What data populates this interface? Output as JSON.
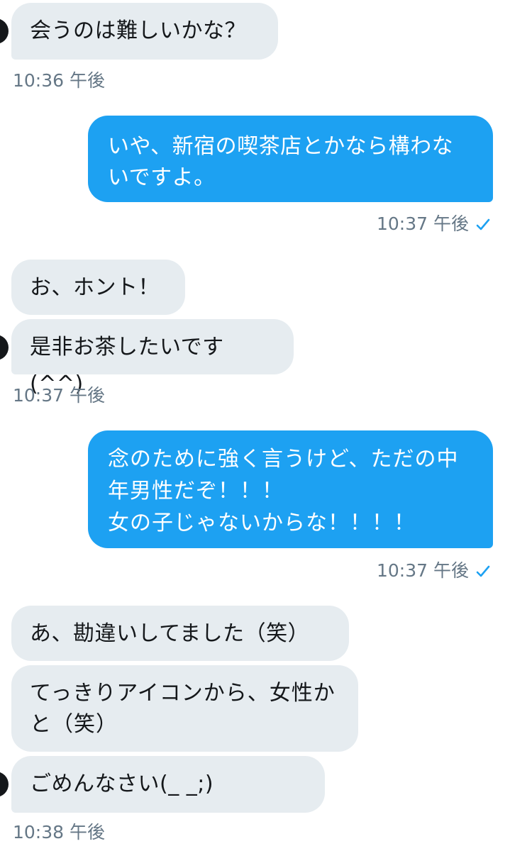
{
  "conversation": {
    "colors": {
      "incoming_bubble": "#e6ecf0",
      "outgoing_bubble": "#1da1f2",
      "timestamp": "#657786",
      "check": "#1da1f2"
    },
    "groups": [
      {
        "direction": "incoming",
        "messages": [
          "会うのは難しいかな？"
        ],
        "time": "10:36 午後"
      },
      {
        "direction": "outgoing",
        "messages": [
          "いや、新宿の喫茶店とかなら構わないですよ。"
        ],
        "time": "10:37 午後",
        "read_icon": "check-icon"
      },
      {
        "direction": "incoming",
        "messages": [
          "お、ホント！",
          "是非お茶したいです(^^)"
        ],
        "time": "10:37 午後"
      },
      {
        "direction": "outgoing",
        "messages": [
          "念のために強く言うけど、ただの中年男性だぞ！！！\n女の子じゃないからな！！！！"
        ],
        "time": "10:37 午後",
        "read_icon": "check-icon"
      },
      {
        "direction": "incoming",
        "messages": [
          "あ、勘違いしてました（笑）",
          "てっきりアイコンから、女性かと（笑）",
          "ごめんなさい(_ _;)"
        ],
        "time": "10:38 午後"
      }
    ]
  }
}
